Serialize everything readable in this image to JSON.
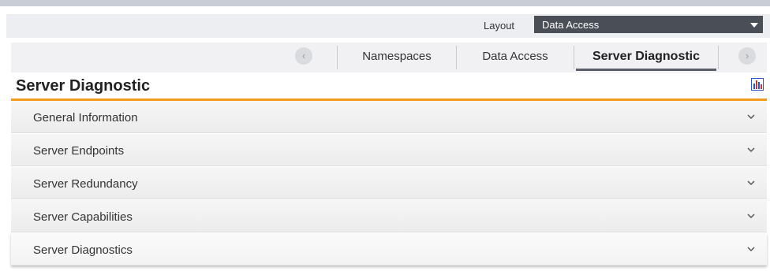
{
  "layout": {
    "label": "Layout",
    "selected": "Data Access"
  },
  "tabs": [
    {
      "label": "Namespaces"
    },
    {
      "label": "Data Access"
    },
    {
      "label": "Server Diagnostic"
    }
  ],
  "nav": {
    "prev": "‹",
    "next": "›"
  },
  "panel": {
    "title": "Server Diagnostic",
    "icon": "bar-chart-icon"
  },
  "sections": [
    {
      "label": "General Information"
    },
    {
      "label": "Server Endpoints"
    },
    {
      "label": "Server Redundancy"
    },
    {
      "label": "Server Capabilities"
    },
    {
      "label": "Server Diagnostics"
    }
  ],
  "colors": {
    "accent": "#f39b1d",
    "select_bg": "#4a4f57"
  }
}
